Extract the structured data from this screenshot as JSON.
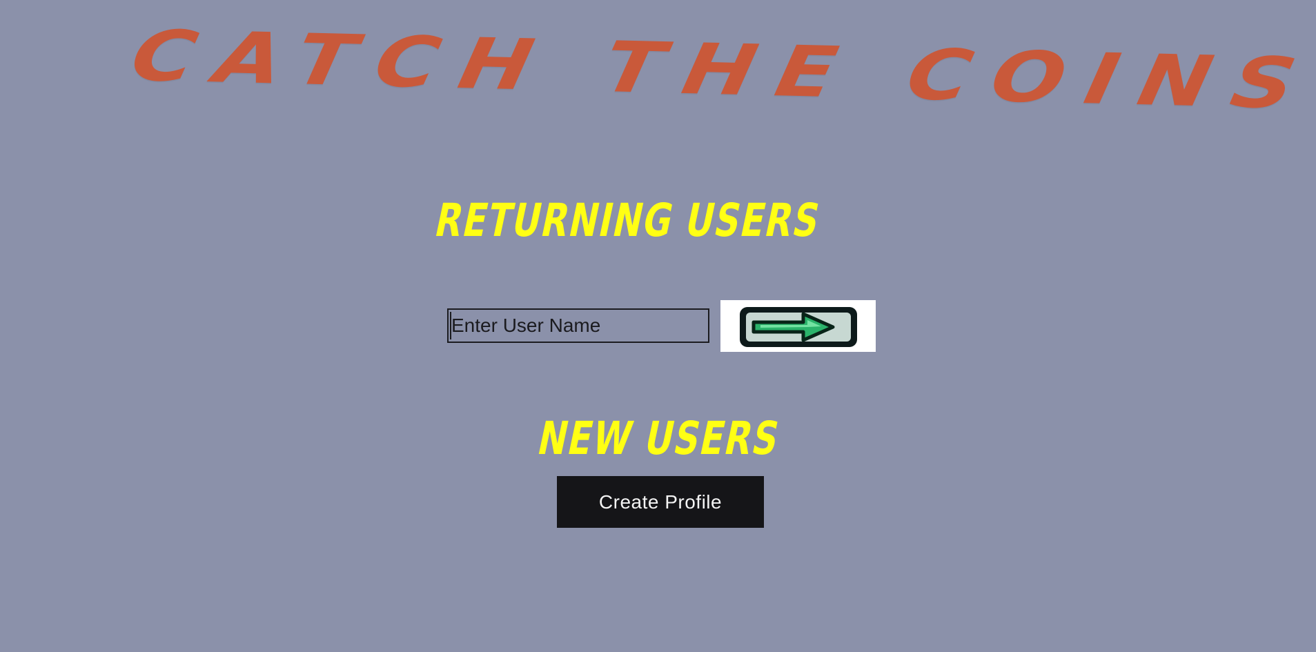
{
  "title": "CATCH THE COINS",
  "returning_users": {
    "heading": "RETURNING USERS",
    "username_input": {
      "placeholder": "Enter User Name",
      "value": ""
    },
    "submit_icon": "right-arrow-icon"
  },
  "new_users": {
    "heading": "NEW USERS",
    "create_profile_label": "Create Profile"
  },
  "colors": {
    "background": "#8b91aa",
    "title": "#c9593a",
    "headings": "#ffff14",
    "button": "#151518",
    "button_text": "#f4f4f4",
    "arrow": "#2bb36b"
  }
}
